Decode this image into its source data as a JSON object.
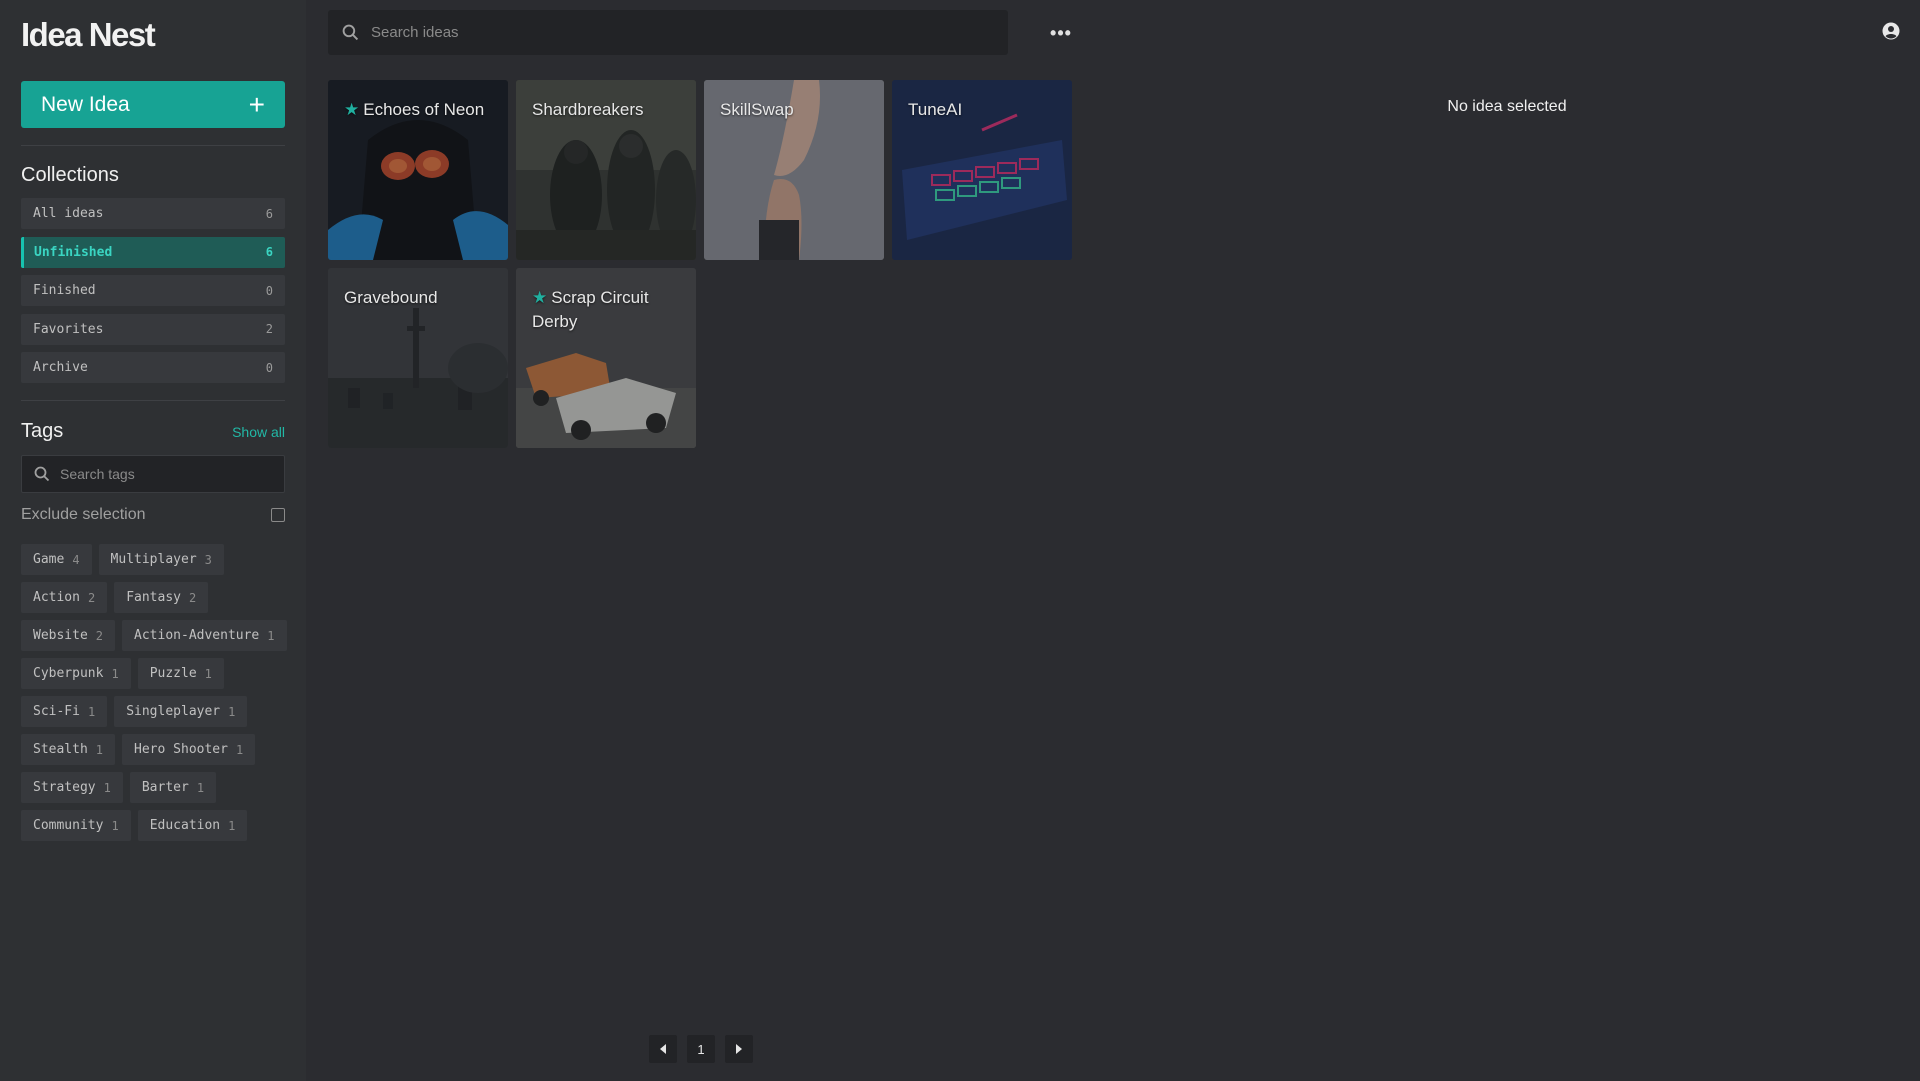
{
  "app": {
    "title": "Idea Nest"
  },
  "sidebar": {
    "new_idea_label": "New Idea",
    "collections_title": "Collections",
    "collections": [
      {
        "label": "All ideas",
        "count": "6",
        "active": false
      },
      {
        "label": "Unfinished",
        "count": "6",
        "active": true
      },
      {
        "label": "Finished",
        "count": "0",
        "active": false
      },
      {
        "label": "Favorites",
        "count": "2",
        "active": false
      },
      {
        "label": "Archive",
        "count": "0",
        "active": false
      }
    ],
    "tags_title": "Tags",
    "show_all_label": "Show all",
    "tag_search_placeholder": "Search tags",
    "exclude_label": "Exclude selection",
    "tags": [
      {
        "label": "Game",
        "count": "4"
      },
      {
        "label": "Multiplayer",
        "count": "3"
      },
      {
        "label": "Action",
        "count": "2"
      },
      {
        "label": "Fantasy",
        "count": "2"
      },
      {
        "label": "Website",
        "count": "2"
      },
      {
        "label": "Action-Adventure",
        "count": "1"
      },
      {
        "label": "Cyberpunk",
        "count": "1"
      },
      {
        "label": "Puzzle",
        "count": "1"
      },
      {
        "label": "Sci-Fi",
        "count": "1"
      },
      {
        "label": "Singleplayer",
        "count": "1"
      },
      {
        "label": "Stealth",
        "count": "1"
      },
      {
        "label": "Hero Shooter",
        "count": "1"
      },
      {
        "label": "Strategy",
        "count": "1"
      },
      {
        "label": "Barter",
        "count": "1"
      },
      {
        "label": "Community",
        "count": "1"
      },
      {
        "label": "Education",
        "count": "1"
      }
    ]
  },
  "main": {
    "search_placeholder": "Search ideas",
    "ideas": [
      {
        "title": "Echoes of Neon",
        "favorite": true,
        "art": "neon"
      },
      {
        "title": "Shardbreakers",
        "favorite": false,
        "art": "forest"
      },
      {
        "title": "SkillSwap",
        "favorite": false,
        "art": "hands"
      },
      {
        "title": "TuneAI",
        "favorite": false,
        "art": "synth"
      },
      {
        "title": "Gravebound",
        "favorite": false,
        "art": "grave"
      },
      {
        "title": "Scrap Circuit Derby",
        "favorite": true,
        "art": "derby"
      }
    ],
    "pagination": {
      "current_page": "1"
    }
  },
  "detail": {
    "empty_message": "No idea selected"
  },
  "colors": {
    "accent": "#17a394",
    "active_text": "#3ad5c2",
    "background": "#2b2c30",
    "sidebar": "#2e3033"
  },
  "icons": {
    "search": "search-icon",
    "more": "more-horizontal-icon",
    "user": "user-circle-icon",
    "star": "star-icon",
    "plus": "plus-icon",
    "prev": "caret-left-icon",
    "next": "caret-right-icon"
  }
}
